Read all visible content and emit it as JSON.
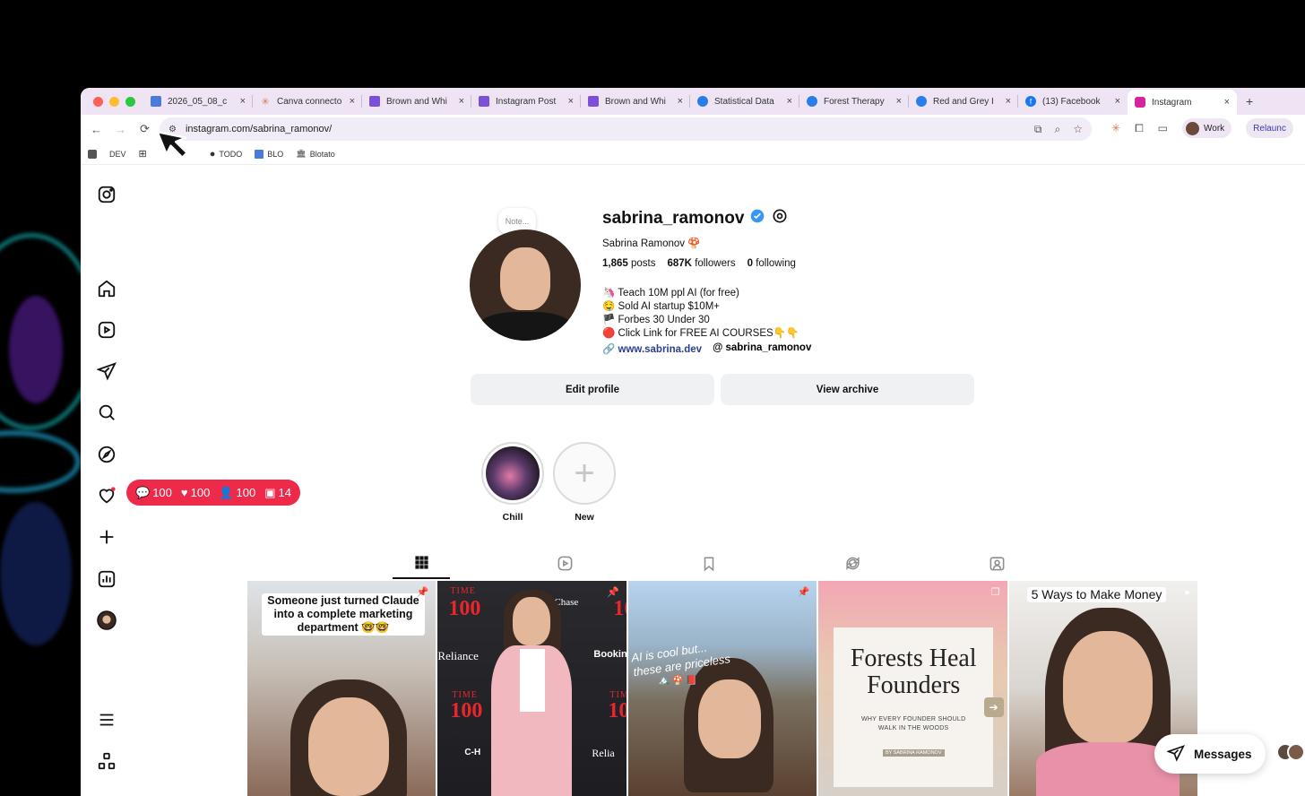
{
  "browser": {
    "tabs": [
      {
        "title": "2026_05_08_c",
        "favicon": "doc-icon",
        "color": "#4a7bd8"
      },
      {
        "title": "Canva connecto",
        "favicon": "claude-icon",
        "color": "#d97757"
      },
      {
        "title": "Brown and Whi",
        "favicon": "canva-icon",
        "color": "#7d4fd6"
      },
      {
        "title": "Instagram Post",
        "favicon": "canva-icon",
        "color": "#7d4fd6"
      },
      {
        "title": "Brown and Whi",
        "favicon": "canva-icon",
        "color": "#7d4fd6"
      },
      {
        "title": "Statistical Data",
        "favicon": "globe-icon",
        "color": "#2b7de9"
      },
      {
        "title": "Forest Therapy",
        "favicon": "globe-icon",
        "color": "#2b7de9"
      },
      {
        "title": "Red and Grey I",
        "favicon": "globe-icon",
        "color": "#2b7de9"
      },
      {
        "title": "(13) Facebook",
        "favicon": "facebook-icon",
        "color": "#1877f2"
      },
      {
        "title": "Instagram",
        "favicon": "instagram-icon",
        "color": "#d6249f"
      }
    ],
    "tab_close": "×",
    "new_tab": "+",
    "url": "instagram.com/sabrina_ramonov/",
    "profile_chip": "Work",
    "relaunch_label": "Relaunc",
    "bookmarks": [
      "DEV",
      "TODO",
      "BLO",
      "Blotato"
    ]
  },
  "notifications": {
    "comments": "100",
    "likes": "100",
    "follows": "100",
    "tags": "14",
    "color": "#ed2a4a"
  },
  "profile": {
    "note": "Note...",
    "username": "sabrina_ramonov",
    "full_name": "Sabrina Ramonov 🍄",
    "stats": {
      "posts": "1,865",
      "posts_label": "posts",
      "followers": "687K",
      "followers_label": "followers",
      "following": "0",
      "following_label": "following"
    },
    "bio": [
      "🦄 Teach 10M ppl AI (for free)",
      "🤤 Sold AI startup $10M+",
      "🏴 Forbes 30 Under 30",
      "🔴 Click Link for FREE AI COURSES👇👇"
    ],
    "website": "www.sabrina.dev",
    "threads": "sabrina_ramonov",
    "edit_profile": "Edit profile",
    "view_archive": "View archive",
    "highlights": [
      {
        "label": "Chill"
      },
      {
        "label": "New"
      }
    ]
  },
  "posts": {
    "p1_caption": "Someone just turned Claude into a complete marketing department 🤓🤓",
    "p2_time": "TIME",
    "p2_100": "100",
    "p2_chase": "Chase",
    "p2_reliance": "Reliance",
    "p2_booking": "Bookin",
    "p2_ch": "C-H",
    "p2_rel2": "Relia",
    "p2_ti": "TIM",
    "p2_10": "10",
    "p3_caption": "AI is cool but... these are priceless",
    "p3_emoji": "🏔️ 🍄 📕",
    "p4_title": "Forests Heal Founders",
    "p4_sub": "WHY EVERY FOUNDER SHOULD WALK IN THE WOODS",
    "p4_by": "BY SABRINA RAMONOV",
    "p5_caption": "5 Ways to Make Money"
  },
  "messages": {
    "label": "Messages"
  }
}
